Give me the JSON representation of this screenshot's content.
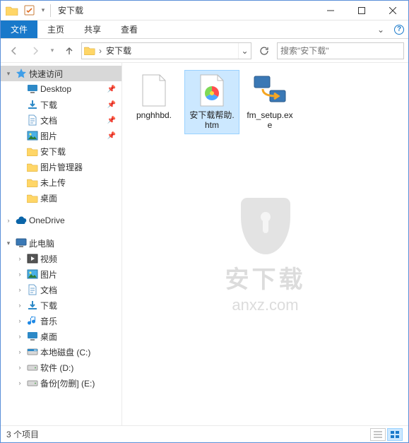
{
  "window": {
    "title": "安下载"
  },
  "ribbon": {
    "file": "文件",
    "tabs": [
      "主页",
      "共享",
      "查看"
    ]
  },
  "navbar": {
    "breadcrumb_sep": "›",
    "path": "安下载",
    "search_placeholder": "搜索\"安下载\""
  },
  "tree": {
    "quick_access": "快速访问",
    "quick_items": [
      {
        "label": "Desktop",
        "icon": "desktop",
        "pinned": true
      },
      {
        "label": "下载",
        "icon": "downloads",
        "pinned": true
      },
      {
        "label": "文档",
        "icon": "documents",
        "pinned": true
      },
      {
        "label": "图片",
        "icon": "pictures",
        "pinned": true
      },
      {
        "label": "安下载",
        "icon": "folder",
        "pinned": false
      },
      {
        "label": "图片管理器",
        "icon": "folder",
        "pinned": false
      },
      {
        "label": "未上传",
        "icon": "folder",
        "pinned": false
      },
      {
        "label": "桌面",
        "icon": "folder",
        "pinned": false
      }
    ],
    "onedrive": "OneDrive",
    "this_pc": "此电脑",
    "pc_items": [
      {
        "label": "视频",
        "icon": "videos"
      },
      {
        "label": "图片",
        "icon": "pictures"
      },
      {
        "label": "文档",
        "icon": "documents"
      },
      {
        "label": "下载",
        "icon": "downloads"
      },
      {
        "label": "音乐",
        "icon": "music"
      },
      {
        "label": "桌面",
        "icon": "desktop"
      },
      {
        "label": "本地磁盘 (C:)",
        "icon": "drive-c"
      },
      {
        "label": "软件 (D:)",
        "icon": "drive"
      },
      {
        "label": "备份[勿删] (E:)",
        "icon": "drive"
      }
    ]
  },
  "files": [
    {
      "name": "pnghhbd.",
      "type": "blank",
      "selected": false
    },
    {
      "name": "安下载帮助.htm",
      "type": "htm",
      "selected": true
    },
    {
      "name": "fm_setup.exe",
      "type": "exe",
      "selected": false
    }
  ],
  "status": {
    "item_count": "3 个项目"
  },
  "watermark": {
    "cn": "安下载",
    "en": "anxz.com"
  }
}
